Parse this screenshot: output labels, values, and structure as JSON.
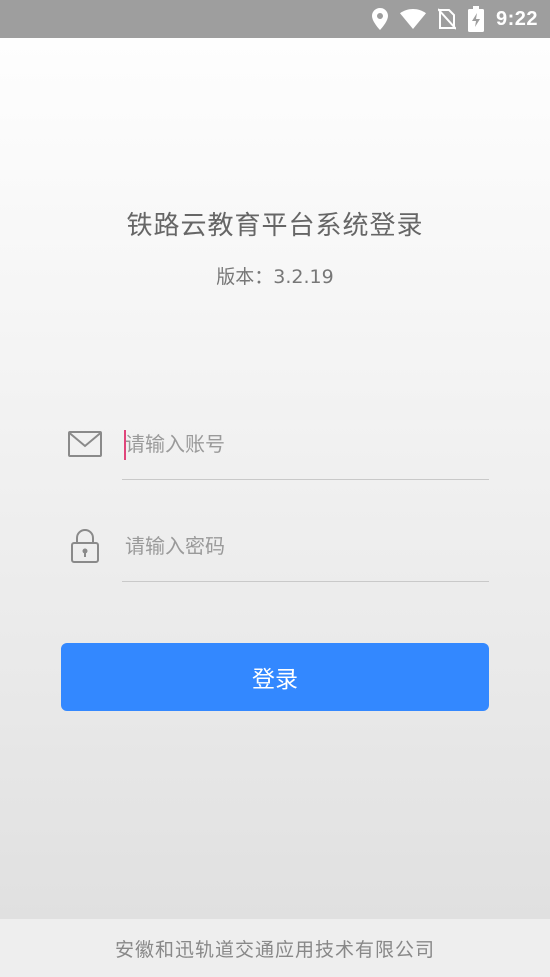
{
  "status_bar": {
    "time": "9:22",
    "icons": [
      "location-icon",
      "wifi-icon",
      "no-sim-icon",
      "battery-charging-icon"
    ]
  },
  "app": {
    "title": "铁路云教育平台系统登录",
    "version": "版本：3.2.19"
  },
  "login_form": {
    "account": {
      "placeholder": "请输入账号",
      "value": "",
      "icon": "mail-icon"
    },
    "password": {
      "placeholder": "请输入密码",
      "value": "",
      "icon": "lock-icon"
    },
    "submit_label": "登录"
  },
  "footer": {
    "company": "安徽和迅轨道交通应用技术有限公司"
  },
  "colors": {
    "primary": "#3388ff",
    "status_bar": "#9e9e9e",
    "cursor": "#e0457b"
  }
}
